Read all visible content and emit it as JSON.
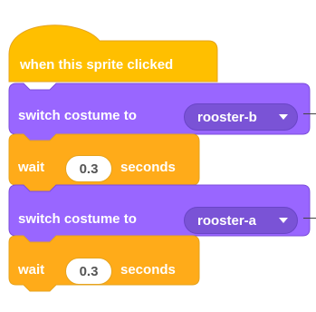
{
  "colors": {
    "events": "#FFBF00",
    "events_border": "#E6A31D",
    "looks": "#9966FF",
    "looks_border": "#7C4DDB",
    "dropdown": "#7A53D6",
    "control": "#FFAB19"
  },
  "script": {
    "hat": {
      "label": "when this sprite clicked"
    },
    "blocks": [
      {
        "type": "looks",
        "label": "switch costume to",
        "costume": "rooster-b"
      },
      {
        "type": "control",
        "label": "wait",
        "value": "0.3",
        "suffix": "seconds"
      },
      {
        "type": "looks",
        "label": "switch costume to",
        "costume": "rooster-a"
      },
      {
        "type": "control",
        "label": "wait",
        "value": "0.3",
        "suffix": "seconds"
      }
    ]
  }
}
